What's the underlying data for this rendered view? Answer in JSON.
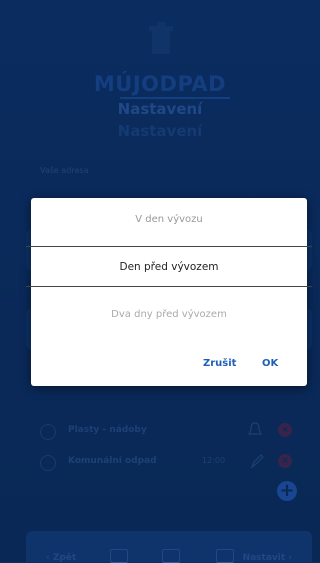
{
  "app": {
    "brand": "MÚJODPAD",
    "title_primary": "Nastavení",
    "title_secondary": "Nastavení",
    "address_label": "Vaše adresa"
  },
  "waste_rows": [
    {
      "label": "Plasty - nádoby",
      "time": ""
    },
    {
      "label": "Komunální odpad",
      "time": "12:00"
    }
  ],
  "bottom_bar": {
    "back_label": "‹ Zpět",
    "next_label": "Nastavit ›"
  },
  "dialog": {
    "options": [
      "V den vývozu",
      "Den před vývozem",
      "Dva dny před vývozem"
    ],
    "selected_index": 1,
    "cancel_label": "Zrušit",
    "ok_label": "OK"
  },
  "colors": {
    "background": "#0c2f63",
    "accent": "#1f5fb8",
    "dialog_bg": "#ffffff"
  }
}
